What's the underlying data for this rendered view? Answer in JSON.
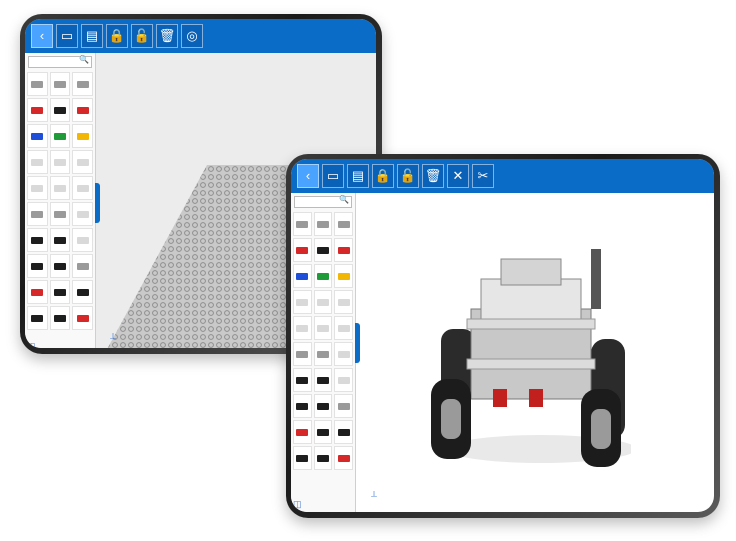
{
  "toolbar_left": [
    "back-icon",
    "folder-icon",
    "save-icon",
    "lock-icon",
    "unlock-icon",
    "trash-icon",
    "camera-icon"
  ],
  "toolbar_right": [
    "back-icon",
    "folder-icon",
    "save-icon",
    "lock-icon",
    "unlock-icon",
    "trash-icon",
    "wrench-icon",
    "scissors-icon"
  ],
  "icon_glyphs": {
    "back-icon": "‹",
    "folder-icon": "▭",
    "save-icon": "▤",
    "lock-icon": "🔒",
    "unlock-icon": "🔓",
    "trash-icon": "🗑",
    "camera-icon": "◎",
    "wrench-icon": "✕",
    "scissors-icon": "✂"
  },
  "colors": {
    "toolbar": "#0b6cc8",
    "red": "#d62828",
    "black": "#1e1e1e",
    "blue": "#1f4fd8",
    "green": "#1f9b3a",
    "yellow": "#f2b705",
    "gray": "#9a9a9a",
    "light": "#d9d9d9"
  }
}
